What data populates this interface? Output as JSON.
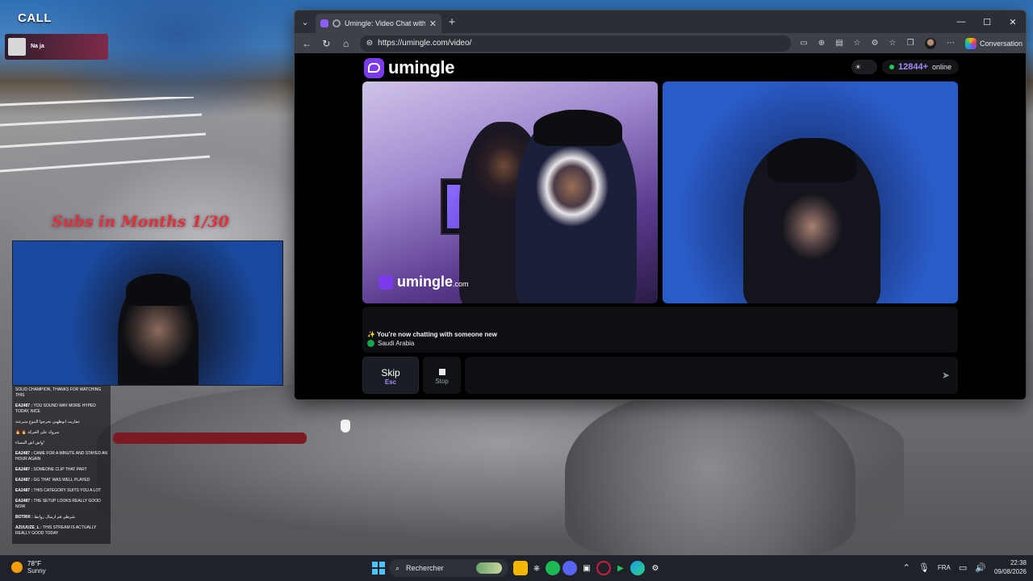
{
  "stream": {
    "title": "CALL",
    "alert": {
      "label": "Na ja",
      "sub_text": ""
    },
    "subs_goal": "Subs in Months   1/30",
    "chat": [
      {
        "user": "",
        "text": "SOLID CHAMPION, THANKS FOR WATCHING THIS"
      },
      {
        "user": "EA2487 :",
        "text": "YOU SOUND WAY MORE HYPED TODAY, NICE"
      },
      {
        "user": "",
        "text": "عفاريت ابوظهبي تخرجوا البتوع متبرعتة"
      },
      {
        "user": "",
        "text": "🔥 🔥 مبروك على الحركة"
      },
      {
        "user": "",
        "text": "واش اش المساء!"
      },
      {
        "user": "EA2487 :",
        "text": "CAME FOR A MINUTE AND STAYED AN HOUR AGAIN"
      },
      {
        "user": "EA2487 :",
        "text": "SOMEONE CLIP THAT PART"
      },
      {
        "user": "EA2487 :",
        "text": "GG THAT WAS WELL PLAYED"
      },
      {
        "user": "EA2487 :",
        "text": "THIS CATEGORY SUITS YOU A LOT"
      },
      {
        "user": "EA2487 :",
        "text": "THE SETUP LOOKS REALLY GOOD NOW"
      },
      {
        "user": "BOTRIX :",
        "text": "شرطي فم ارسال روابط"
      },
      {
        "user": "AZUUUZE_L :",
        "text": "THIS STREAM IS ACTUALLY REALLY GOOD TODAY"
      }
    ]
  },
  "browser": {
    "tab_title": "Umingle: Video Chat with Stra",
    "url": "https://umingle.com/video/",
    "conversation_label": "Conversation",
    "window_controls": {
      "minimize": "—",
      "maximize": "☐",
      "close": "✕"
    }
  },
  "umingle": {
    "logo_text": "umingle",
    "online_count": "12844+",
    "online_label": "online",
    "watermark": {
      "name": "umingle",
      "suffix": ".com"
    },
    "status_new": "✨ You're now chatting with someone new",
    "country": "Saudi Arabia",
    "skip_label": "Skip",
    "skip_key": "Esc",
    "stop_label": "Stop",
    "message_placeholder": ""
  },
  "taskbar": {
    "weather_temp": "78°F",
    "weather_desc": "Sunny",
    "search_label": "Rechercher",
    "language": "FRA",
    "time": "22:38",
    "date": "09/08/2026"
  },
  "colors": {
    "accent": "#7c3aed",
    "online": "#22c55e",
    "count": "#a78bfa"
  }
}
